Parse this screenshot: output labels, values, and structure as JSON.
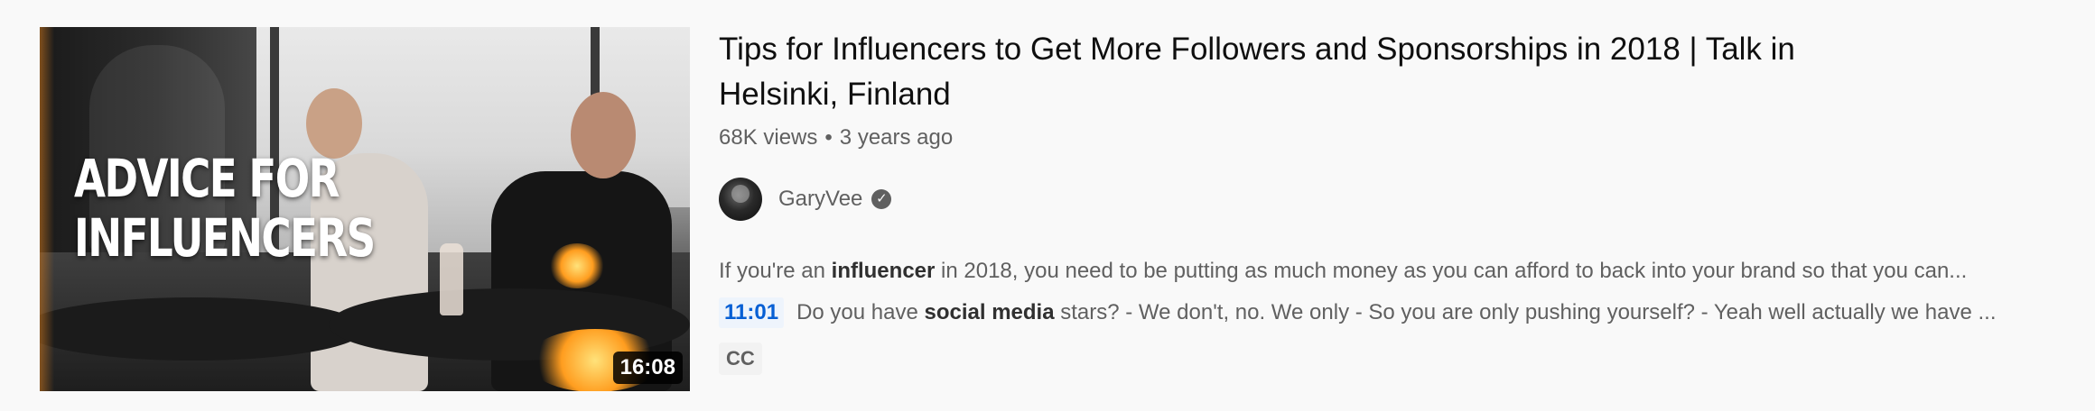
{
  "video": {
    "thumbnail_overlay_line1": "ADVICE FOR",
    "thumbnail_overlay_line2": "INFLUENCERS",
    "duration": "16:08",
    "title": "Tips for Influencers to Get More Followers and Sponsorships in 2018 | Talk in Helsinki, Finland",
    "views": "68K views",
    "separator": "•",
    "age": "3 years ago",
    "channel": {
      "name": "GaryVee",
      "verified_icon": "check-circle-icon",
      "verified_glyph": "✓"
    },
    "description": {
      "before": "If you're an ",
      "bold": "influencer",
      "after": " in 2018, you need to be putting as much money as you can afford to back into your brand so that you can..."
    },
    "snippet": {
      "timestamp": "11:01",
      "before": "Do you have ",
      "bold": "social media",
      "after": " stars? - We don't, no. We only - So you are only pushing yourself? - Yeah well actually we have ..."
    },
    "badge": "CC"
  },
  "colors": {
    "background": "#f9f9f9",
    "title": "#0f0f0f",
    "meta": "#606060",
    "timestamp": "#065fd4"
  }
}
